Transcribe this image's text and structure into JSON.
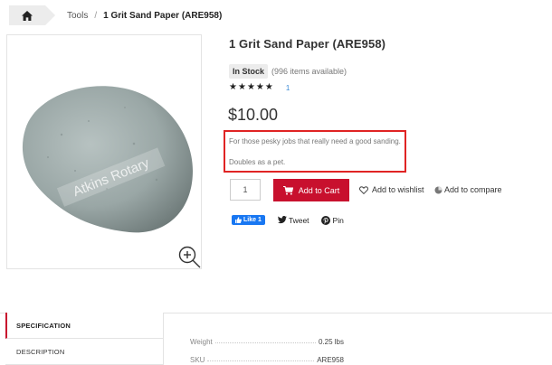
{
  "breadcrumb": {
    "home_icon": "home-icon",
    "tools": "Tools",
    "separator": "/",
    "current": "1 Grit Sand Paper (ARE958)"
  },
  "product": {
    "image_watermark": "Atkins Rotary",
    "title": "1 Grit Sand Paper (ARE958)",
    "stock_badge": "In Stock",
    "stock_count": "(996 items available)",
    "rating": 5,
    "rating_max": 5,
    "review_count": "1",
    "price": "$10.00",
    "description": [
      "For those pesky jobs that really need a good sanding.",
      "Doubles as a pet."
    ],
    "quantity": "1"
  },
  "actions": {
    "add_to_cart": "Add to Cart",
    "add_to_wishlist": "Add to wishlist",
    "add_to_compare": "Add to compare"
  },
  "social": {
    "fb_like": "Like 1",
    "tweet": "Tweet",
    "pin": "Pin"
  },
  "tabs": [
    {
      "label": "SPECIFICATION",
      "active": true
    },
    {
      "label": "DESCRIPTION",
      "active": false
    }
  ],
  "specs": [
    {
      "label": "Weight",
      "value": "0.25 lbs"
    },
    {
      "label": "SKU",
      "value": "ARE958"
    }
  ],
  "colors": {
    "accent_red": "#c8102e",
    "highlight_border": "#e02424",
    "link_blue": "#3a8ad6",
    "facebook_blue": "#1877f2"
  }
}
